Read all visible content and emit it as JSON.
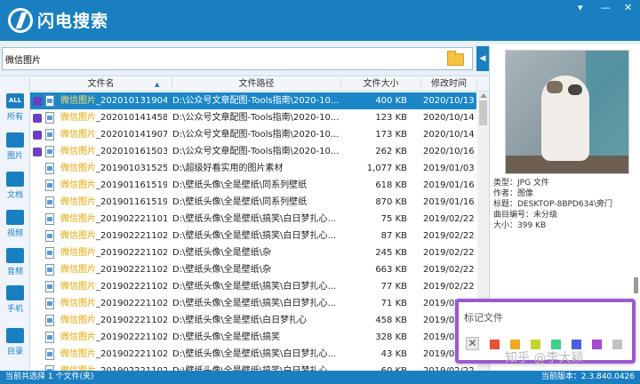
{
  "app": {
    "title": "闪电搜索",
    "version": "当前版本：2.3.840.0426"
  },
  "window_controls": [
    "▾",
    "—",
    "✕"
  ],
  "search": {
    "value": "微信图片"
  },
  "sidebar": [
    {
      "label": "所有",
      "icon": "ALL"
    },
    {
      "label": "图片",
      "icon": "image"
    },
    {
      "label": "文档",
      "icon": "document"
    },
    {
      "label": "视频",
      "icon": "video"
    },
    {
      "label": "音频",
      "icon": "audio"
    },
    {
      "label": "手机",
      "icon": "phone"
    },
    {
      "label": "目录",
      "icon": "folder"
    }
  ],
  "columns": {
    "name": "文件名",
    "path": "文件路径",
    "size": "文件大小",
    "date": "修改时间"
  },
  "rows": [
    {
      "hl": "微信图片",
      "name": "_202010131904...",
      "path": "D:\\公众号文章配图-Tools指南\\2020-10...",
      "size": "400 KB",
      "date": "2020/10/13 1",
      "tagged": true,
      "selected": true
    },
    {
      "hl": "微信图片",
      "name": "_202010141458...",
      "path": "D:\\公众号文章配图-Tools指南\\2020-10...",
      "size": "123 KB",
      "date": "2020/10/14 1",
      "tagged": true,
      "selected": false
    },
    {
      "hl": "微信图片",
      "name": "_202010141907...",
      "path": "D:\\公众号文章配图-Tools指南\\2020-10...",
      "size": "173 KB",
      "date": "2020/10/14 1",
      "tagged": true,
      "selected": false
    },
    {
      "hl": "微信图片",
      "name": "_202010161503...",
      "path": "D:\\公众号文章配图-Tools指南\\2020-10...",
      "size": "262 KB",
      "date": "2020/10/16 1",
      "tagged": true,
      "selected": false
    },
    {
      "hl": "微信图片",
      "name": "_20190103152510...",
      "path": "D:\\超级好看实用的图片素材",
      "size": "1,077 KB",
      "date": "2019/01/03 1",
      "tagged": false,
      "selected": false
    },
    {
      "hl": "微信图片",
      "name": "_20190116151954...",
      "path": "D:\\壁纸头像\\全是壁纸\\同系列壁纸",
      "size": "618 KB",
      "date": "2019/01/16 1",
      "tagged": false,
      "selected": false
    },
    {
      "hl": "微信图片",
      "name": "_20190116151957...",
      "path": "D:\\壁纸头像\\全是壁纸\\同系列壁纸",
      "size": "870 KB",
      "date": "2019/01/16 1",
      "tagged": false,
      "selected": false
    },
    {
      "hl": "微信图片",
      "name": "_20190222110154...",
      "path": "D:\\壁纸头像\\全是壁纸\\搞笑\\白日梦扎心...",
      "size": "75 KB",
      "date": "2019/02/22 1",
      "tagged": false,
      "selected": false
    },
    {
      "hl": "微信图片",
      "name": "_20190222110207...",
      "path": "D:\\壁纸头像\\全是壁纸\\搞笑\\白日梦扎心...",
      "size": "87 KB",
      "date": "2019/02/22 1",
      "tagged": false,
      "selected": false
    },
    {
      "hl": "微信图片",
      "name": "_20190222110212...",
      "path": "D:\\壁纸头像\\全是壁纸\\杂",
      "size": "245 KB",
      "date": "2019/02/22 1",
      "tagged": false,
      "selected": false
    },
    {
      "hl": "微信图片",
      "name": "_20190222110216...",
      "path": "D:\\壁纸头像\\全是壁纸\\杂",
      "size": "663 KB",
      "date": "2019/02/22 1",
      "tagged": false,
      "selected": false
    },
    {
      "hl": "微信图片",
      "name": "_20190222110219...",
      "path": "D:\\壁纸头像\\全是壁纸\\搞笑\\白日梦扎心...",
      "size": "77 KB",
      "date": "2019/02/22 1",
      "tagged": false,
      "selected": false
    },
    {
      "hl": "微信图片",
      "name": "_20190222110222...",
      "path": "D:\\壁纸头像\\全是壁纸\\搞笑\\白日梦扎心...",
      "size": "71 KB",
      "date": "2019/02/22 1",
      "tagged": false,
      "selected": false
    },
    {
      "hl": "微信图片",
      "name": "_20190222110225...",
      "path": "D:\\壁纸头像\\全是壁纸\\白日梦扎心",
      "size": "458 KB",
      "date": "2019/02/22 1",
      "tagged": false,
      "selected": false
    },
    {
      "hl": "微信图片",
      "name": "_20190222110230...",
      "path": "D:\\壁纸头像\\全是壁纸\\搞笑",
      "size": "328 KB",
      "date": "2019/02/22 1",
      "tagged": false,
      "selected": false
    },
    {
      "hl": "微信图片",
      "name": "_20190222110233...",
      "path": "D:\\壁纸头像\\全是壁纸\\搞笑\\白日梦扎心...",
      "size": "43 KB",
      "date": "2019/02/22 1",
      "tagged": false,
      "selected": false
    },
    {
      "hl": "微信图片",
      "name": "_20190222110237...",
      "path": "D:\\壁纸头像\\全是壁纸\\搞笑\\白日梦扎心...",
      "size": "60 KB",
      "date": "2019/02/22 1",
      "tagged": false,
      "selected": false
    }
  ],
  "preview": {
    "meta": [
      "类型：JPG 文件",
      "作者：图像",
      "标题：DESKTOP-8BPD634\\旁门",
      "曲目编号：未分级",
      "大小：399 KB"
    ]
  },
  "status": {
    "left": "当前共选择 1 个文件(夹)"
  },
  "tag_popup": {
    "title": "标记文件",
    "close": "✕",
    "colors": [
      "#e8503a",
      "#f5a623",
      "#c8d62c",
      "#3ecf8e",
      "#4b5fe0",
      "#a64bd0",
      "#c2c2c2"
    ]
  },
  "watermark": "知乎 @李大颖"
}
